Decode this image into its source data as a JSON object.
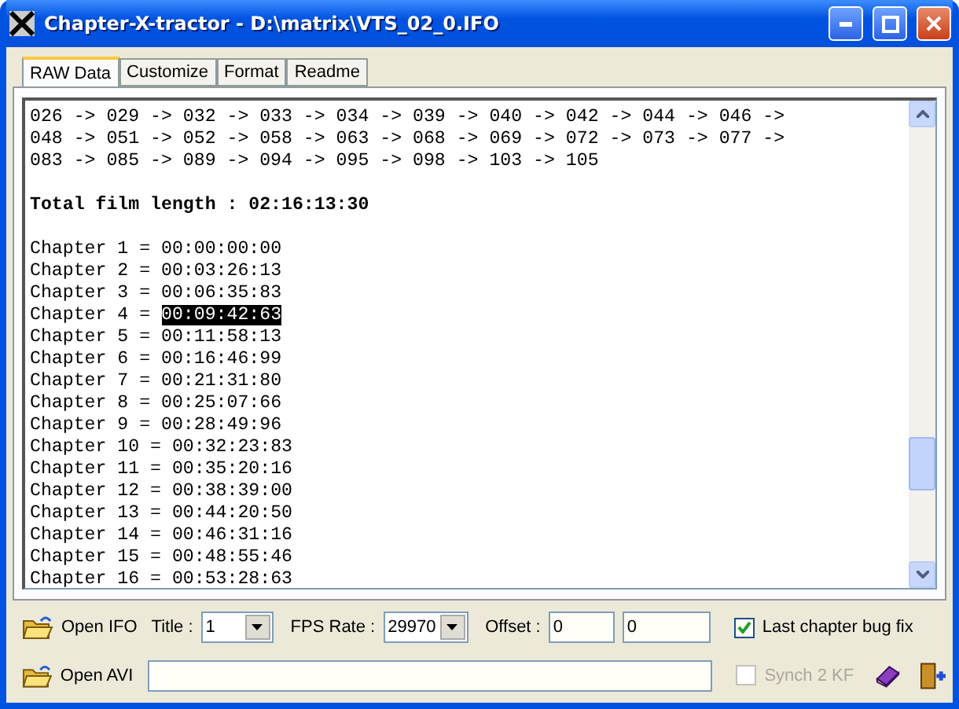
{
  "window": {
    "title": "Chapter-X-tractor - D:\\matrix\\VTS_02_0.IFO"
  },
  "tabs": [
    {
      "label": "RAW Data",
      "selected": true
    },
    {
      "label": "Customize",
      "selected": false
    },
    {
      "label": "Format",
      "selected": false
    },
    {
      "label": "Readme",
      "selected": false
    }
  ],
  "raw_text": {
    "sequence_lines": [
      "026 -> 029 -> 032 -> 033 -> 034 -> 039 -> 040 -> 042 -> 044 -> 046 ->",
      "048 -> 051 -> 052 -> 058 -> 063 -> 068 -> 069 -> 072 -> 073 -> 077 ->",
      "083 -> 085 -> 089 -> 094 -> 095 -> 098 -> 103 -> 105"
    ],
    "total_length": "Total film length : 02:16:13:30",
    "chapters": [
      {
        "label": "Chapter 1 =",
        "time": "00:00:00:00",
        "selected": false
      },
      {
        "label": "Chapter 2 =",
        "time": "00:03:26:13",
        "selected": false
      },
      {
        "label": "Chapter 3 =",
        "time": "00:06:35:83",
        "selected": false
      },
      {
        "label": "Chapter 4 =",
        "time": "00:09:42:63",
        "selected": true
      },
      {
        "label": "Chapter 5 =",
        "time": "00:11:58:13",
        "selected": false
      },
      {
        "label": "Chapter 6 =",
        "time": "00:16:46:99",
        "selected": false
      },
      {
        "label": "Chapter 7 =",
        "time": "00:21:31:80",
        "selected": false
      },
      {
        "label": "Chapter 8 =",
        "time": "00:25:07:66",
        "selected": false
      },
      {
        "label": "Chapter 9 =",
        "time": "00:28:49:96",
        "selected": false
      },
      {
        "label": "Chapter 10 =",
        "time": "00:32:23:83",
        "selected": false
      },
      {
        "label": "Chapter 11 =",
        "time": "00:35:20:16",
        "selected": false
      },
      {
        "label": "Chapter 12 =",
        "time": "00:38:39:00",
        "selected": false
      },
      {
        "label": "Chapter 13 =",
        "time": "00:44:20:50",
        "selected": false
      },
      {
        "label": "Chapter 14 =",
        "time": "00:46:31:16",
        "selected": false
      },
      {
        "label": "Chapter 15 =",
        "time": "00:48:55:46",
        "selected": false
      },
      {
        "label": "Chapter 16 =",
        "time": "00:53:28:63",
        "selected": false
      }
    ]
  },
  "controls": {
    "open_ifo": {
      "label": "Open IFO"
    },
    "title_select": {
      "label": "Title :",
      "value": "1"
    },
    "fps_select": {
      "label": "FPS Rate :",
      "value": "29970"
    },
    "offset": {
      "label": "Offset :",
      "values": [
        "0",
        "0"
      ]
    },
    "last_chapter_fix": {
      "label": "Last chapter bug fix",
      "checked": true,
      "disabled": false
    },
    "open_avi": {
      "label": "Open AVI"
    },
    "synch": {
      "label": "Synch 2 KF",
      "checked": false,
      "disabled": true
    }
  }
}
